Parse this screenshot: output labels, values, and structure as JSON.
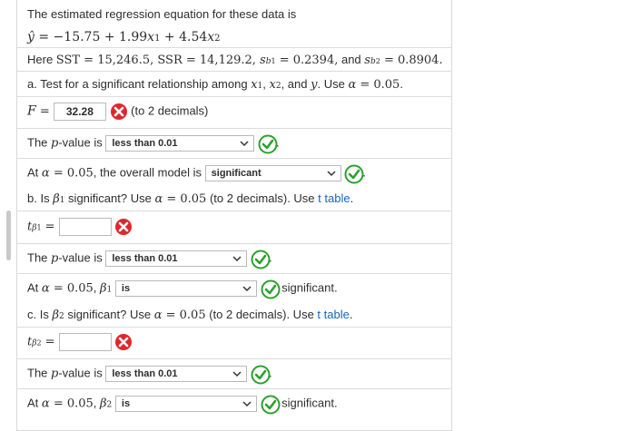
{
  "intro": {
    "line1": "The estimated regression equation for these data is",
    "equation": "ŷ = −15.75 + 1.99x₁ + 4.54x₂",
    "given": "Here SST = 15,246.5, SSR = 14,129.2, s_b₁ = 0.2394, and s_b₂ = 0.8904."
  },
  "part_a": {
    "question": "a. Test for a significant relationship among x₁, x₂, and y. Use α = 0.05.",
    "f_label": "F =",
    "f_value": "32.28",
    "f_hint": "(to 2 decimals)",
    "f_status": "incorrect",
    "pvalue_prefix": "The p-value is",
    "pvalue_selected": "less than 0.01",
    "pvalue_status": "correct",
    "conclusion_prefix": "At α = 0.05, the overall model is",
    "conclusion_selected": "significant",
    "conclusion_status": "correct"
  },
  "part_b": {
    "question_pre": "b. Is β₁ significant? Use α = 0.05 (to 2 decimals). Use",
    "table_link": "t table",
    "question_post": ".",
    "t_label": "t_β₁ =",
    "t_value": "",
    "t_status": "incorrect",
    "pvalue_prefix": "The p-value is",
    "pvalue_selected": "less than 0.01",
    "pvalue_status": "correct",
    "conclusion_prefix": "At α = 0.05, β₁",
    "conclusion_selected": "is",
    "conclusion_status": "correct",
    "conclusion_suffix": "significant."
  },
  "part_c": {
    "question_pre": "c. Is β₂ significant? Use α = 0.05 (to 2 decimals). Use",
    "table_link": "t table",
    "question_post": ".",
    "t_label": "t_β₂ =",
    "t_value": "",
    "t_status": "incorrect",
    "pvalue_prefix": "The p-value is",
    "pvalue_selected": "less than 0.01",
    "pvalue_status": "correct",
    "conclusion_prefix": "At α = 0.05, β₂",
    "conclusion_selected": "is",
    "conclusion_status": "correct",
    "conclusion_suffix": "significant."
  },
  "colors": {
    "correct": "#2ca02c",
    "incorrect": "#e0262d",
    "link": "#1565c0"
  },
  "icons": {
    "correct": "check-circle-icon",
    "incorrect": "x-circle-icon",
    "dropdown": "chevron-down-icon"
  }
}
